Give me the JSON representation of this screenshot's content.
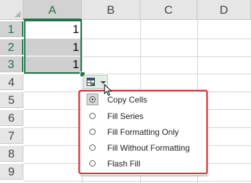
{
  "columns": [
    "A",
    "B",
    "C",
    "D"
  ],
  "rows": [
    "1",
    "2",
    "3",
    "4",
    "5",
    "6",
    "7",
    "8",
    "9"
  ],
  "cells": {
    "A1": "1",
    "A2": "1",
    "A3": "1"
  },
  "selection": "A1:A3",
  "autofill_button": {
    "icon": "autofill-options-icon"
  },
  "menu": {
    "items": [
      {
        "label": "Copy Cells",
        "selected": true
      },
      {
        "label": "Fill Series",
        "selected": false
      },
      {
        "label": "Fill Formatting Only",
        "selected": false
      },
      {
        "label": "Fill Without Formatting",
        "selected": false
      },
      {
        "label": "Flash Fill",
        "selected": false
      }
    ]
  },
  "colors": {
    "accent": "#217346",
    "highlight": "#d9262c",
    "selected_fill": "#cfcfcf"
  }
}
